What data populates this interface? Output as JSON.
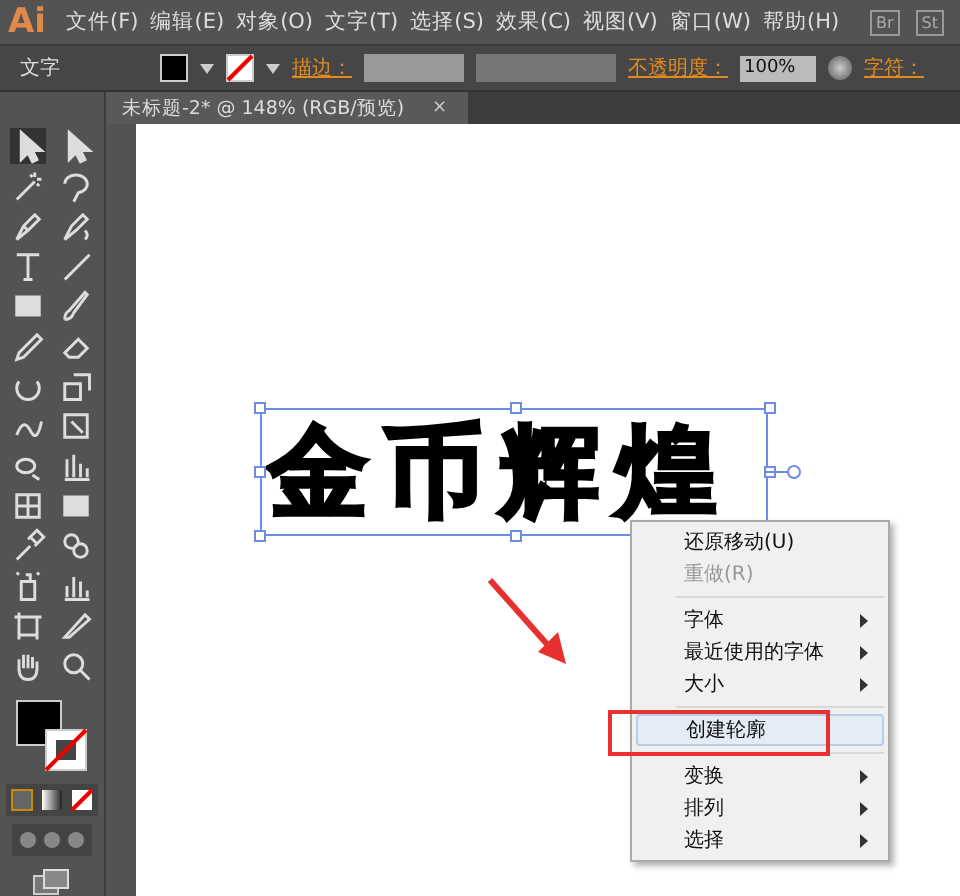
{
  "app": {
    "logo": "Ai",
    "buttons": [
      "Br",
      "St"
    ]
  },
  "menu_bar": [
    "文件(F)",
    "编辑(E)",
    "对象(O)",
    "文字(T)",
    "选择(S)",
    "效果(C)",
    "视图(V)",
    "窗口(W)",
    "帮助(H)"
  ],
  "control_bar": {
    "label": "文字",
    "stroke_label": "描边：",
    "opacity_label": "不透明度：",
    "opacity": "100%",
    "character_label": "字符："
  },
  "document_tab": {
    "title": "未标题-2* @ 148% (RGB/预览)",
    "close": "×"
  },
  "artwork": {
    "text": "金币辉煌",
    "selected": true
  },
  "context_menu": {
    "groups": [
      [
        {
          "label": "还原移动(U)",
          "disabled": false,
          "submenu": false,
          "selected": false
        },
        {
          "label": "重做(R)",
          "disabled": true,
          "submenu": false,
          "selected": false
        }
      ],
      [
        {
          "label": "字体",
          "disabled": false,
          "submenu": true,
          "selected": false
        },
        {
          "label": "最近使用的字体",
          "disabled": false,
          "submenu": true,
          "selected": false
        },
        {
          "label": "大小",
          "disabled": false,
          "submenu": true,
          "selected": false
        }
      ],
      [
        {
          "label": "创建轮廓",
          "disabled": false,
          "submenu": false,
          "selected": true
        }
      ],
      [
        {
          "label": "变换",
          "disabled": false,
          "submenu": true,
          "selected": false
        },
        {
          "label": "排列",
          "disabled": false,
          "submenu": true,
          "selected": false
        },
        {
          "label": "选择",
          "disabled": false,
          "submenu": true,
          "selected": false
        }
      ]
    ]
  }
}
